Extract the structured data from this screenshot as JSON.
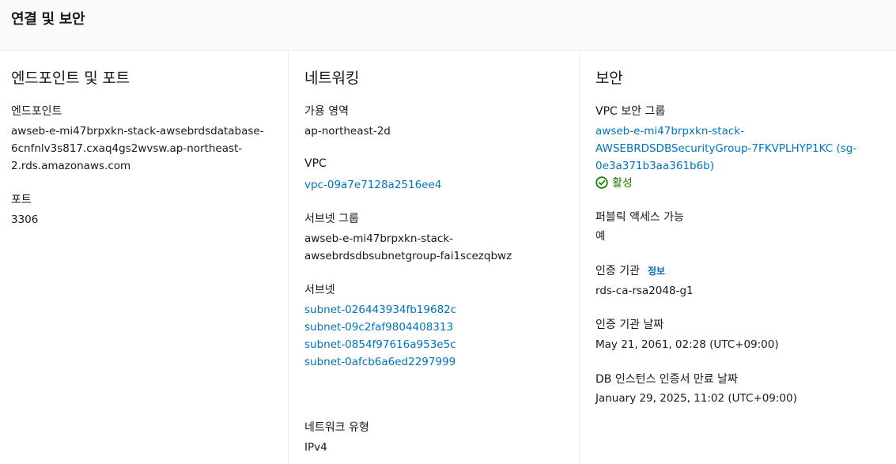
{
  "header": {
    "title": "연결 및 보안"
  },
  "endpoint_port": {
    "title": "엔드포인트 및 포트",
    "endpoint_label": "엔드포인트",
    "endpoint_lines": [
      "awseb-e-mi47brpxkn-stack-awsebrdsdatabase-",
      "6cnfnlv3s817.cxaq4gs2wvsw.ap-northeast-",
      "2.rds.amazonaws.com"
    ],
    "port_label": "포트",
    "port_value": "3306"
  },
  "networking": {
    "title": "네트워킹",
    "az_label": "가용 영역",
    "az_value": "ap-northeast-2d",
    "vpc_label": "VPC",
    "vpc_value": "vpc-09a7e7128a2516ee4",
    "subnet_group_label": "서브넷 그룹",
    "subnet_group_lines": [
      "awseb-e-mi47brpxkn-stack-",
      "awsebrdsdbsubnetgroup-fai1scezqbwz"
    ],
    "subnets_label": "서브넷",
    "subnets": [
      "subnet-026443934fb19682c",
      "subnet-09c2faf9804408313",
      "subnet-0854f97616a953e5c",
      "subnet-0afcb6a6ed2297999"
    ],
    "network_type_label": "네트워크 유형",
    "network_type_value": "IPv4"
  },
  "security": {
    "title": "보안",
    "sg_label": "VPC 보안 그룹",
    "sg_lines": [
      "awseb-e-mi47brpxkn-stack-",
      "AWSEBRDSDBSecurityGroup-7FKVPLHYP1KC (sg-",
      "0e3a371b3aa361b6b)"
    ],
    "sg_status": "활성",
    "public_label": "퍼블릭 액세스 가능",
    "public_value": "예",
    "ca_label": "인증 기관",
    "ca_info": "정보",
    "ca_value": "rds-ca-rsa2048-g1",
    "ca_date_label": "인증 기관 날짜",
    "ca_date_value": "May 21, 2061, 02:28 (UTC+09:00)",
    "cert_expiry_label": "DB 인스턴스 인증서 만료 날짜",
    "cert_expiry_value": "January 29, 2025, 11:02 (UTC+09:00)"
  },
  "colors": {
    "link": "#0073bb",
    "success": "#1d8102",
    "text": "#16191f"
  },
  "icons": {
    "status_active": "check-circle-icon"
  }
}
